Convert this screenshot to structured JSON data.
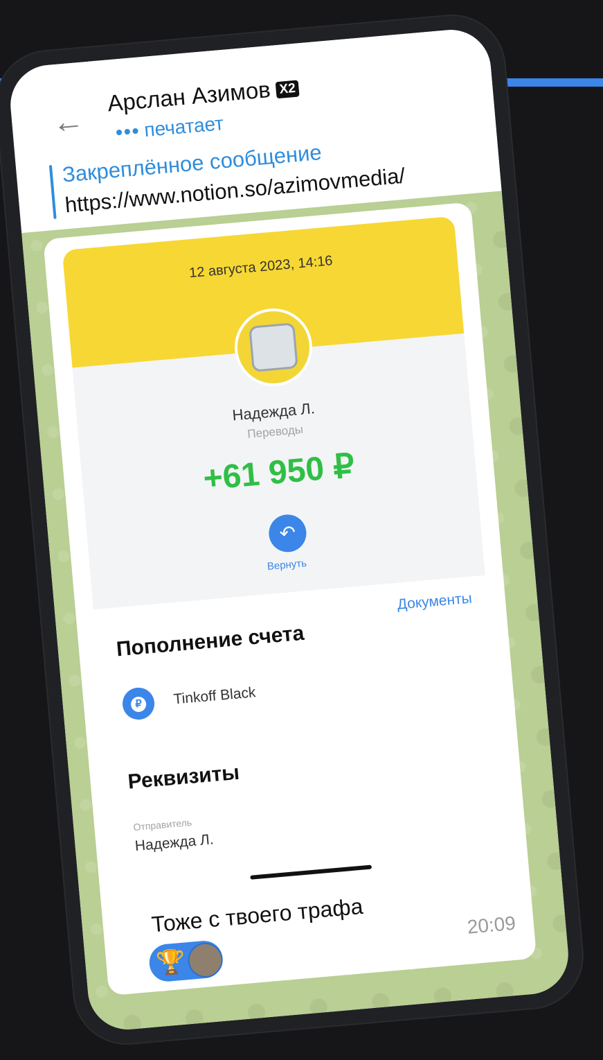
{
  "header": {
    "contact_name": "Арслан Азимов",
    "badge": "X2",
    "status": "печатает",
    "status_dots": "•••"
  },
  "pinned": {
    "title": "Закреплённое сообщение",
    "link": "https://www.notion.so/azimovmedia/"
  },
  "receipt": {
    "date": "12 августа 2023, 14:16",
    "sender_name": "Надежда Л.",
    "category": "Переводы",
    "amount": "+61 950 ₽",
    "return_label": "Вернуть",
    "documents_label": "Документы",
    "topup_title": "Пополнение счета",
    "card_name": "Tinkoff Black",
    "requisites_title": "Реквизиты",
    "sender_label": "Отправитель",
    "sender_value": "Надежда Л."
  },
  "message": {
    "text": "Тоже с твоего трафа",
    "time": "20:09"
  },
  "icons": {
    "back": "arrow-left-icon",
    "return": "return-arrow-icon",
    "card": "ruble-icon",
    "reaction": "trophy-icon"
  },
  "colors": {
    "accent": "#3b86e8",
    "amount_green": "#2fbf45",
    "bank_yellow": "#f7d733",
    "chat_background": "#b9cf93"
  }
}
